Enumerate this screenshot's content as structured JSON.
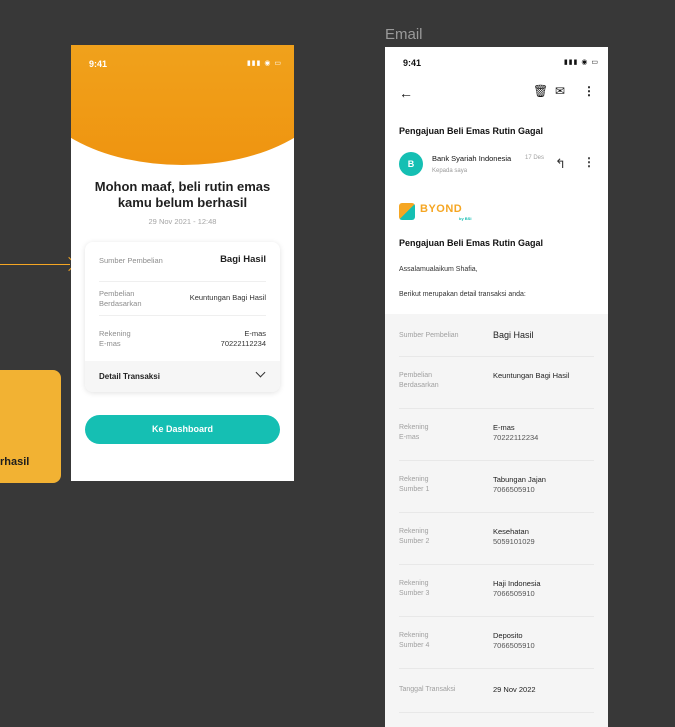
{
  "note": {
    "text": "rhasil"
  },
  "failure_screen": {
    "status_time": "9:41",
    "status_icons": "▮▮▮ ◉ ▭",
    "title": "Mohon maaf, beli rutin emas kamu belum berhasil",
    "date": "29 Nov 2021 - 12:48",
    "rows": [
      {
        "label": "Sumber Pembelian",
        "value": "Bagi Hasil"
      },
      {
        "label": "Pembelian\nBerdasarkan",
        "value": "Keuntungan Bagi Hasil"
      },
      {
        "label": "Rekening\nE-mas",
        "value": "E-mas\n70222112234"
      }
    ],
    "detail_label": "Detail Transaksi",
    "button_label": "Ke Dashboard"
  },
  "email_section_label": "Email",
  "email_screen": {
    "status_time": "9:41",
    "status_icons": "▮▮▮ ◉ ▭",
    "subject": "Pengajuan Beli Emas Rutin Gagal",
    "avatar_initial": "B",
    "sender": "Bank Syariah Indonesia",
    "sender_date": "17 Des",
    "recipient": "Kepada saya",
    "logo_text": "BYOND",
    "logo_sub": "by BSI",
    "heading": "Pengajuan Beli Emas Rutin Gagal",
    "greeting": "Assalamualaikum Shafia,",
    "intro": "Berikut merupakan detail transaksi anda:",
    "rows": [
      {
        "label": "Sumber Pembelian",
        "value": "Bagi Hasil",
        "sub": ""
      },
      {
        "label": "Pembelian\nBerdasarkan",
        "value": "Keuntungan Bagi Hasil",
        "sub": ""
      },
      {
        "label": "Rekening\nE-mas",
        "value": "E-mas",
        "sub": "70222112234"
      },
      {
        "label": "Rekening\nSumber 1",
        "value": "Tabungan Jajan",
        "sub": "7066505910"
      },
      {
        "label": "Rekening\nSumber 2",
        "value": "Kesehatan",
        "sub": "5059101029"
      },
      {
        "label": "Rekening\nSumber 3",
        "value": "Haji Indonesia",
        "sub": "7066505910"
      },
      {
        "label": "Rekening\nSumber 4",
        "value": "Deposito",
        "sub": "7066505910"
      },
      {
        "label": "Tanggal Transaksi",
        "value": "29 Nov 2022",
        "sub": ""
      }
    ]
  }
}
